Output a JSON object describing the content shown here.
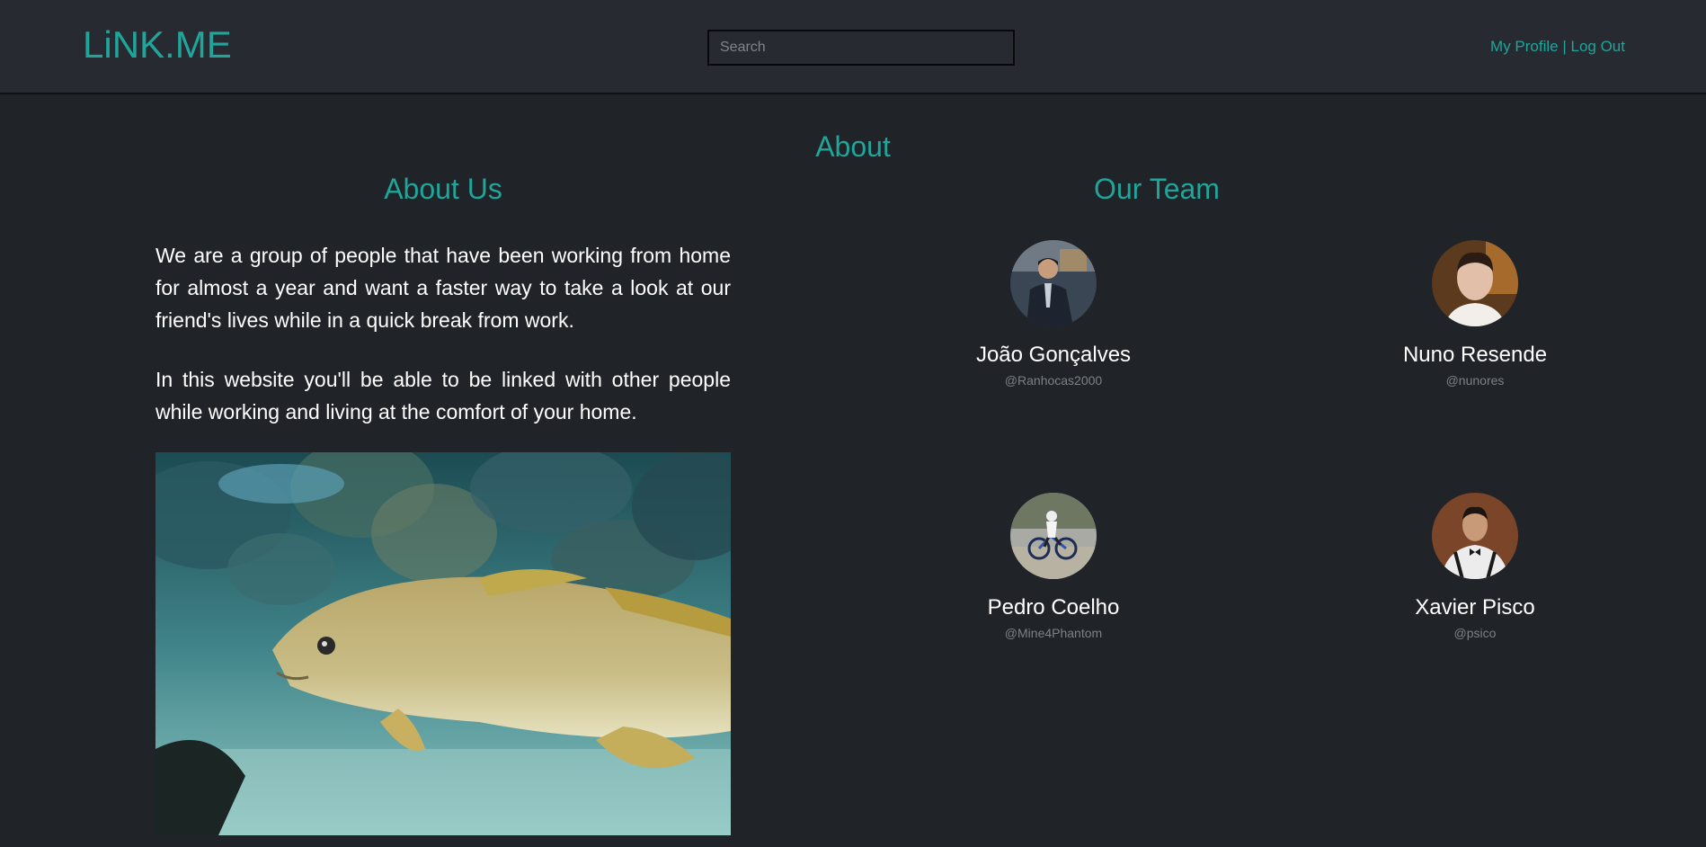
{
  "header": {
    "logo": "LiNK.ME",
    "search_placeholder": "Search",
    "my_profile": "My Profile",
    "separator": " | ",
    "log_out": "Log Out"
  },
  "page": {
    "title": "About"
  },
  "about": {
    "heading": "About Us",
    "paragraph1": "We are a group of people that have been working from home for almost a year and want a faster way to take a look at our friend's lives while in a quick break from work.",
    "paragraph2": "In this website you'll be able to be linked with other people while working and living at the comfort of your home."
  },
  "team": {
    "heading": "Our Team",
    "members": [
      {
        "name": "João Gonçalves",
        "handle": "@Ranhocas2000"
      },
      {
        "name": "Nuno Resende",
        "handle": "@nunores"
      },
      {
        "name": "Pedro Coelho",
        "handle": "@Mine4Phantom"
      },
      {
        "name": "Xavier Pisco",
        "handle": "@psico"
      }
    ]
  },
  "colors": {
    "accent": "#1fa59a",
    "background": "#202328",
    "navbar": "#272b31"
  }
}
